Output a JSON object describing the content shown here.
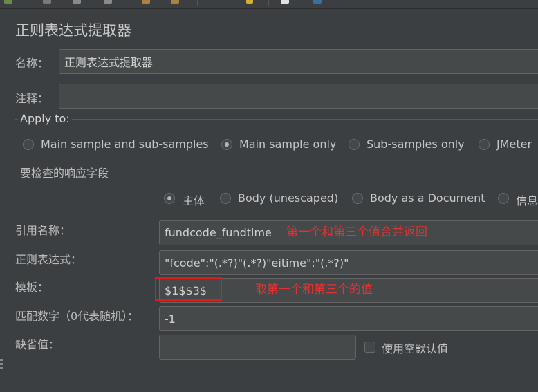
{
  "panel": {
    "title": "正则表达式提取器"
  },
  "name_field": {
    "label": "名称：",
    "value": "正则表达式提取器"
  },
  "comment_field": {
    "label": "注释：",
    "value": ""
  },
  "apply_to": {
    "label": "Apply to:",
    "options": [
      {
        "label": "Main sample and sub-samples",
        "selected": false
      },
      {
        "label": "Main sample only",
        "selected": true
      },
      {
        "label": "Sub-samples only",
        "selected": false
      },
      {
        "label": "JMeter",
        "selected": false
      }
    ]
  },
  "response_field": {
    "label": "要检查的响应字段",
    "options": [
      {
        "label": "主体",
        "selected": true
      },
      {
        "label": "Body (unescaped)",
        "selected": false
      },
      {
        "label": "Body as a Document",
        "selected": false
      },
      {
        "label": "信息",
        "selected": false
      }
    ]
  },
  "ref_name": {
    "label": "引用名称：",
    "value": "fundcode_fundtime"
  },
  "regex": {
    "label": "正则表达式：",
    "value": "\"fcode\":\"(.*?)\"(.*?)\"eitime\":\"(.*?)\""
  },
  "template": {
    "label": "模板：",
    "value": "$1$$3$"
  },
  "match_no": {
    "label": "匹配数字（0代表随机）：",
    "value": "-1"
  },
  "default_value": {
    "label": "缺省值：",
    "value": "",
    "checkbox_label": "使用空默认值",
    "checked": false
  },
  "annotations": {
    "ref_note": "第一个和第三个值合并返回",
    "template_note": "取第一个和第三个的值"
  },
  "colors": {
    "background": "#3c3f41",
    "field": "#45494a",
    "annotation": "#e03333"
  }
}
